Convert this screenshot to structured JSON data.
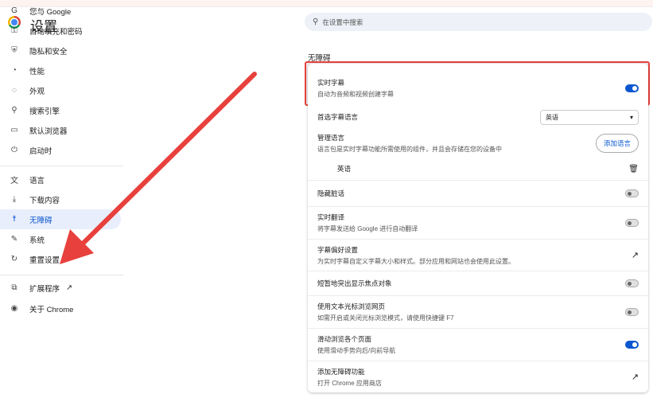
{
  "app": {
    "title": "设置"
  },
  "search": {
    "placeholder": "在设置中搜索"
  },
  "sidebar": {
    "items": [
      {
        "label": "您与 Google",
        "icon": "google-icon"
      },
      {
        "label": "自动填充和密码",
        "icon": "key-icon"
      },
      {
        "label": "隐私和安全",
        "icon": "shield-icon"
      },
      {
        "label": "性能",
        "icon": "speedometer-icon"
      },
      {
        "label": "外观",
        "icon": "palette-icon"
      },
      {
        "label": "搜索引擎",
        "icon": "search-icon"
      },
      {
        "label": "默认浏览器",
        "icon": "browser-icon"
      },
      {
        "label": "启动时",
        "icon": "power-icon"
      },
      {
        "label": "语言",
        "icon": "translate-icon"
      },
      {
        "label": "下载内容",
        "icon": "download-icon"
      },
      {
        "label": "无障碍",
        "icon": "accessibility-icon",
        "active": true
      },
      {
        "label": "系统",
        "icon": "wrench-icon"
      },
      {
        "label": "重置设置",
        "icon": "reset-icon"
      },
      {
        "label": "扩展程序",
        "icon": "extension-icon"
      },
      {
        "label": "关于 Chrome",
        "icon": "chrome-icon"
      }
    ]
  },
  "main": {
    "section_title": "无障碍",
    "live_caption": {
      "title": "实时字幕",
      "subtitle": "自动为音频和视频创建字幕",
      "on": true
    },
    "pref_lang": {
      "title": "首选字幕语言",
      "value": "英语"
    },
    "manage_lang": {
      "title": "管理语言",
      "subtitle": "语言包是实时字幕功能所需使用的组件，并且会存储在您的设备中",
      "button": "添加语言"
    },
    "lang_item": "英语",
    "hide_profanity": {
      "title": "隐藏脏话",
      "on": false
    },
    "live_translate": {
      "title": "实时翻译",
      "subtitle": "将字幕发送给 Google 进行自动翻译",
      "on": false
    },
    "caption_prefs": {
      "title": "字幕偏好设置",
      "subtitle": "为实时字幕自定义字幕大小和样式。部分应用和网站也会使用此设置。"
    },
    "focus_highlight": {
      "title": "短暂地突出显示焦点对象",
      "on": false
    },
    "caret_browsing": {
      "title": "使用文本光标浏览网页",
      "subtitle": "如需开启或关闭光标浏览模式，请使用快捷键 F7",
      "on": false
    },
    "swipe_nav": {
      "title": "滑动浏览各个页面",
      "subtitle": "使用滑动手势向后/向前导航",
      "on": true
    },
    "add_features": {
      "title": "添加无障碍功能",
      "subtitle": "打开 Chrome 应用商店"
    }
  },
  "colors": {
    "accent": "#0b57d0",
    "highlight_border": "#e8403c",
    "arrow": "#e8403c"
  }
}
